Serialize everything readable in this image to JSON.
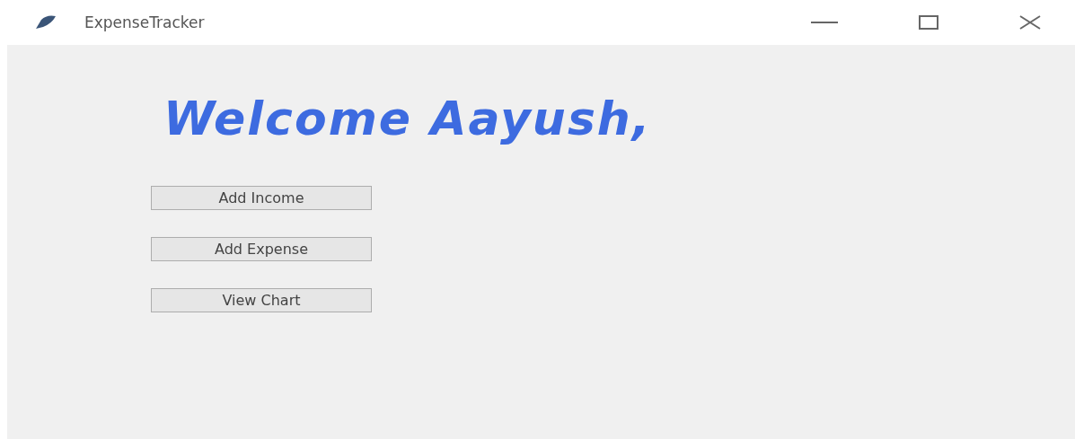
{
  "window": {
    "title": "ExpenseTracker"
  },
  "heading": "Welcome Aayush,",
  "buttons": [
    "Add Income",
    "Add Expense",
    "View Chart"
  ]
}
